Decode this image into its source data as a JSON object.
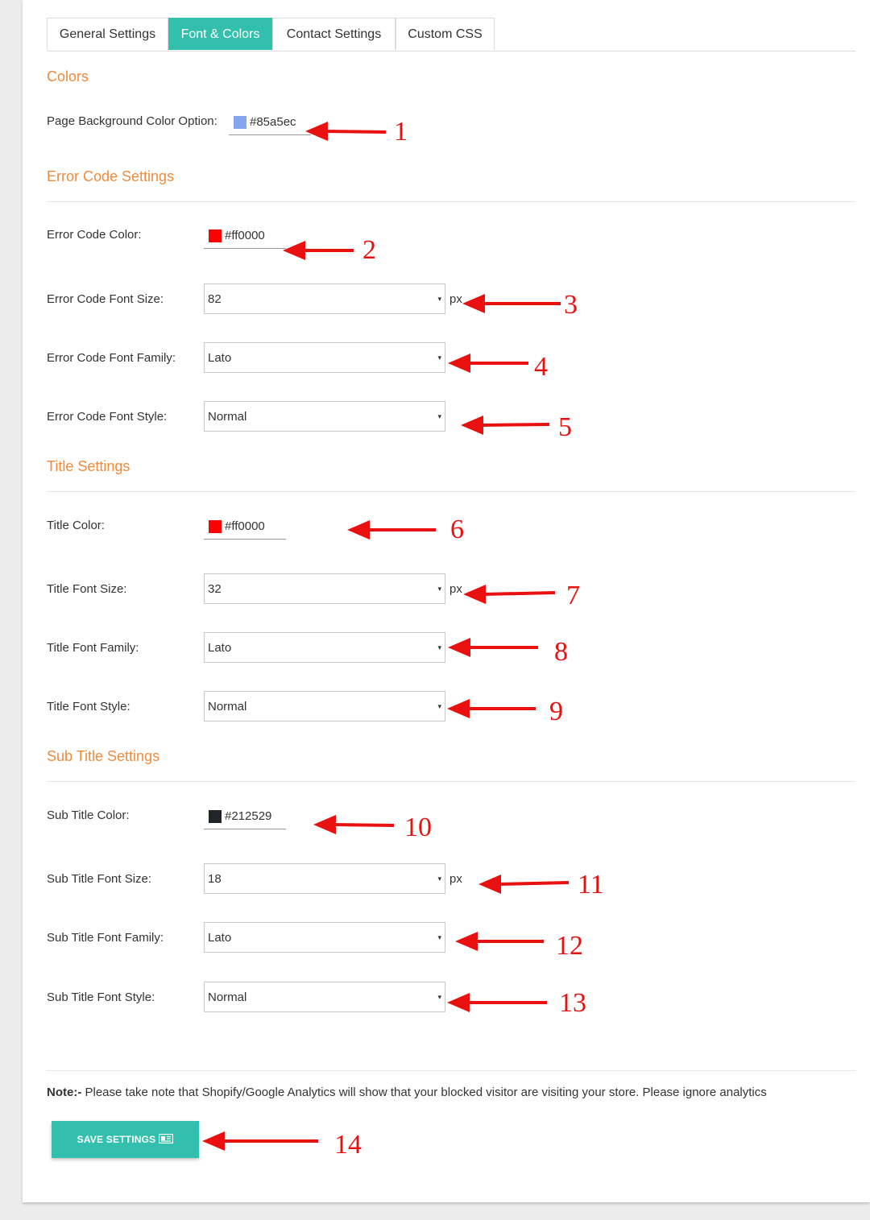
{
  "tabs": [
    {
      "label": "General Settings",
      "active": false
    },
    {
      "label": "Font & Colors",
      "active": true
    },
    {
      "label": "Contact Settings",
      "active": false
    },
    {
      "label": "Custom CSS",
      "active": false
    }
  ],
  "sections": {
    "colors": {
      "title": "Colors",
      "page_bg": {
        "label": "Page Background Color Option:",
        "value": "#85a5ec",
        "swatch": "#85a5ec"
      }
    },
    "error_code": {
      "title": "Error Code Settings",
      "color": {
        "label": "Error Code Color:",
        "value": "#ff0000",
        "swatch": "#ff0000"
      },
      "font_size": {
        "label": "Error Code Font Size:",
        "value": "82",
        "unit": "px"
      },
      "font_family": {
        "label": "Error Code Font Family:",
        "value": "Lato"
      },
      "font_style": {
        "label": "Error Code Font Style:",
        "value": "Normal"
      }
    },
    "title": {
      "title": "Title Settings",
      "color": {
        "label": "Title Color:",
        "value": "#ff0000",
        "swatch": "#ff0000"
      },
      "font_size": {
        "label": "Title Font Size:",
        "value": "32",
        "unit": "px"
      },
      "font_family": {
        "label": "Title Font Family:",
        "value": "Lato"
      },
      "font_style": {
        "label": "Title Font Style:",
        "value": "Normal"
      }
    },
    "sub_title": {
      "title": "Sub Title Settings",
      "color": {
        "label": "Sub Title Color:",
        "value": "#212529",
        "swatch": "#212529"
      },
      "font_size": {
        "label": "Sub Title Font Size:",
        "value": "18",
        "unit": "px"
      },
      "font_family": {
        "label": "Sub Title Font Family:",
        "value": "Lato"
      },
      "font_style": {
        "label": "Sub Title Font Style:",
        "value": "Normal"
      }
    }
  },
  "dropdown_caret": "▾",
  "note": {
    "prefix": "Note:-",
    "text": " Please take note that Shopify/Google Analytics will show that your blocked visitor are visiting your store. Please ignore analytics"
  },
  "save_button": {
    "label": "SAVE SETTINGS",
    "icon": "newspaper-icon"
  },
  "annotations": [
    "1",
    "2",
    "3",
    "4",
    "5",
    "6",
    "7",
    "8",
    "9",
    "10",
    "11",
    "12",
    "13",
    "14"
  ],
  "colors": {
    "accent": "#32bfad",
    "section_title": "#f08a3c",
    "annotation": "#e8110f"
  }
}
